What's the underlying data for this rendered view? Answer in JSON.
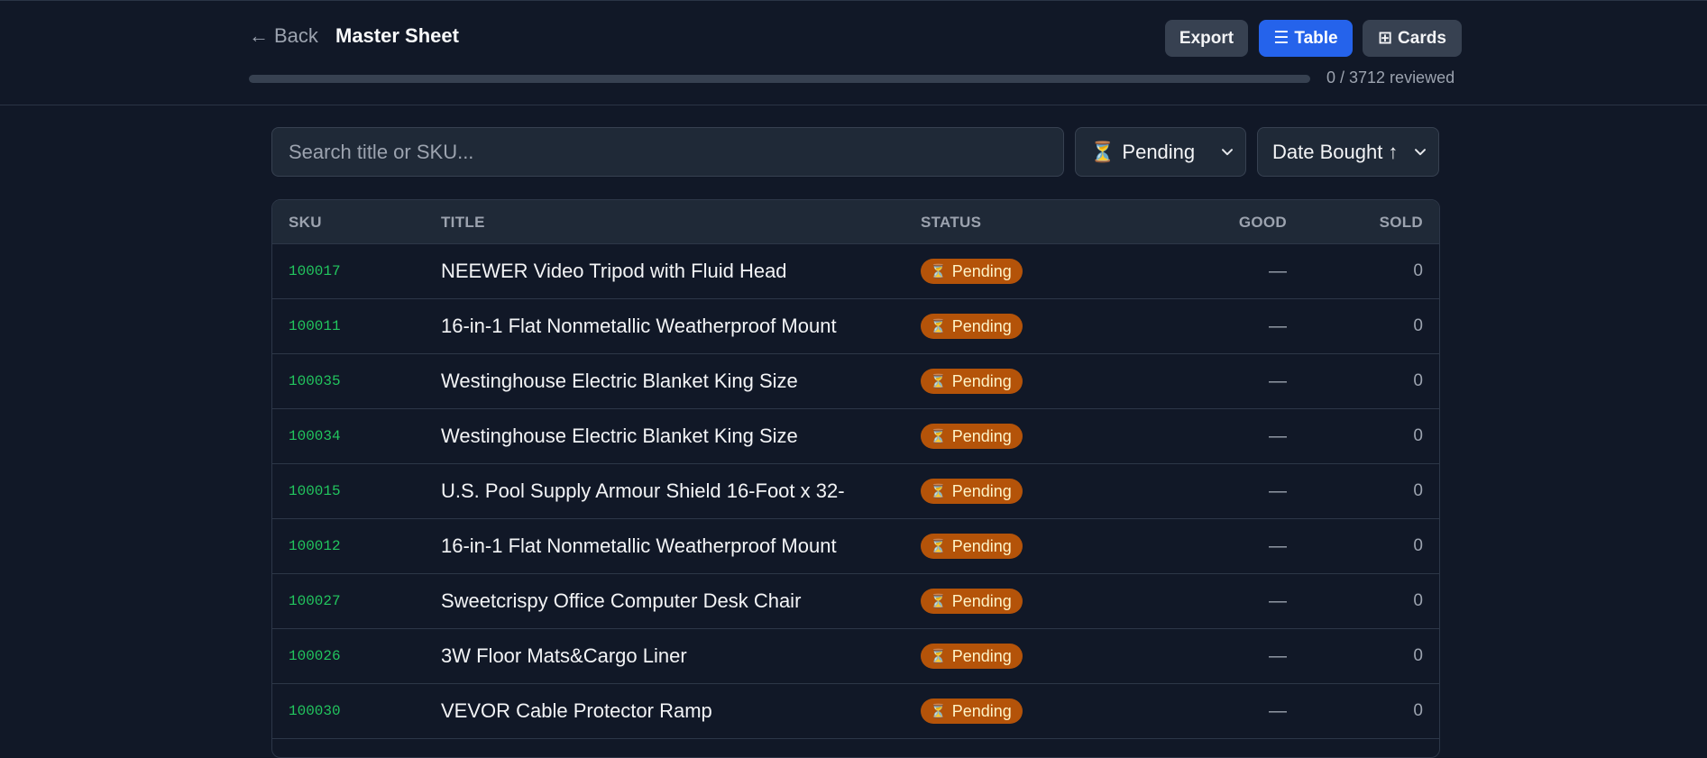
{
  "header": {
    "back_label": "Back",
    "back_arrow": "←",
    "title": "Master Sheet",
    "export_label": "Export",
    "table_label": "Table",
    "table_icon": "☰",
    "cards_label": "Cards",
    "cards_icon": "⊞",
    "progress_fraction": 0,
    "progress_text": "0 / 3712 reviewed"
  },
  "filters": {
    "search_placeholder": "Search title or SKU...",
    "search_value": "",
    "status_icon": "⏳",
    "status_value": "Pending",
    "sort_value": "Date Bought ↑"
  },
  "table": {
    "headers": {
      "sku": "SKU",
      "title": "TITLE",
      "status": "STATUS",
      "good": "GOOD",
      "sold": "SOLD"
    },
    "rows": [
      {
        "sku": "100017",
        "title": "NEEWER Video Tripod with Fluid Head",
        "status": "Pending",
        "good": "—",
        "sold": "0"
      },
      {
        "sku": "100011",
        "title": "16-in-1 Flat Nonmetallic Weatherproof Mount",
        "status": "Pending",
        "good": "—",
        "sold": "0"
      },
      {
        "sku": "100035",
        "title": "Westinghouse Electric Blanket King Size",
        "status": "Pending",
        "good": "—",
        "sold": "0"
      },
      {
        "sku": "100034",
        "title": "Westinghouse Electric Blanket King Size",
        "status": "Pending",
        "good": "—",
        "sold": "0"
      },
      {
        "sku": "100015",
        "title": "U.S. Pool Supply Armour Shield 16-Foot x 32-",
        "status": "Pending",
        "good": "—",
        "sold": "0"
      },
      {
        "sku": "100012",
        "title": "16-in-1 Flat Nonmetallic Weatherproof Mount",
        "status": "Pending",
        "good": "—",
        "sold": "0"
      },
      {
        "sku": "100027",
        "title": "Sweetcrispy Office Computer Desk Chair",
        "status": "Pending",
        "good": "—",
        "sold": "0"
      },
      {
        "sku": "100026",
        "title": "3W Floor Mats&Cargo Liner",
        "status": "Pending",
        "good": "—",
        "sold": "0"
      },
      {
        "sku": "100030",
        "title": "VEVOR Cable Protector Ramp",
        "status": "Pending",
        "good": "—",
        "sold": "0"
      },
      {
        "sku": "",
        "title": "",
        "status": "",
        "good": "",
        "sold": ""
      }
    ],
    "status_icon": "⏳"
  },
  "colors": {
    "background": "#111827",
    "accent": "#2563eb",
    "sku_green": "#22c55e",
    "pending_badge": "#b45309"
  }
}
